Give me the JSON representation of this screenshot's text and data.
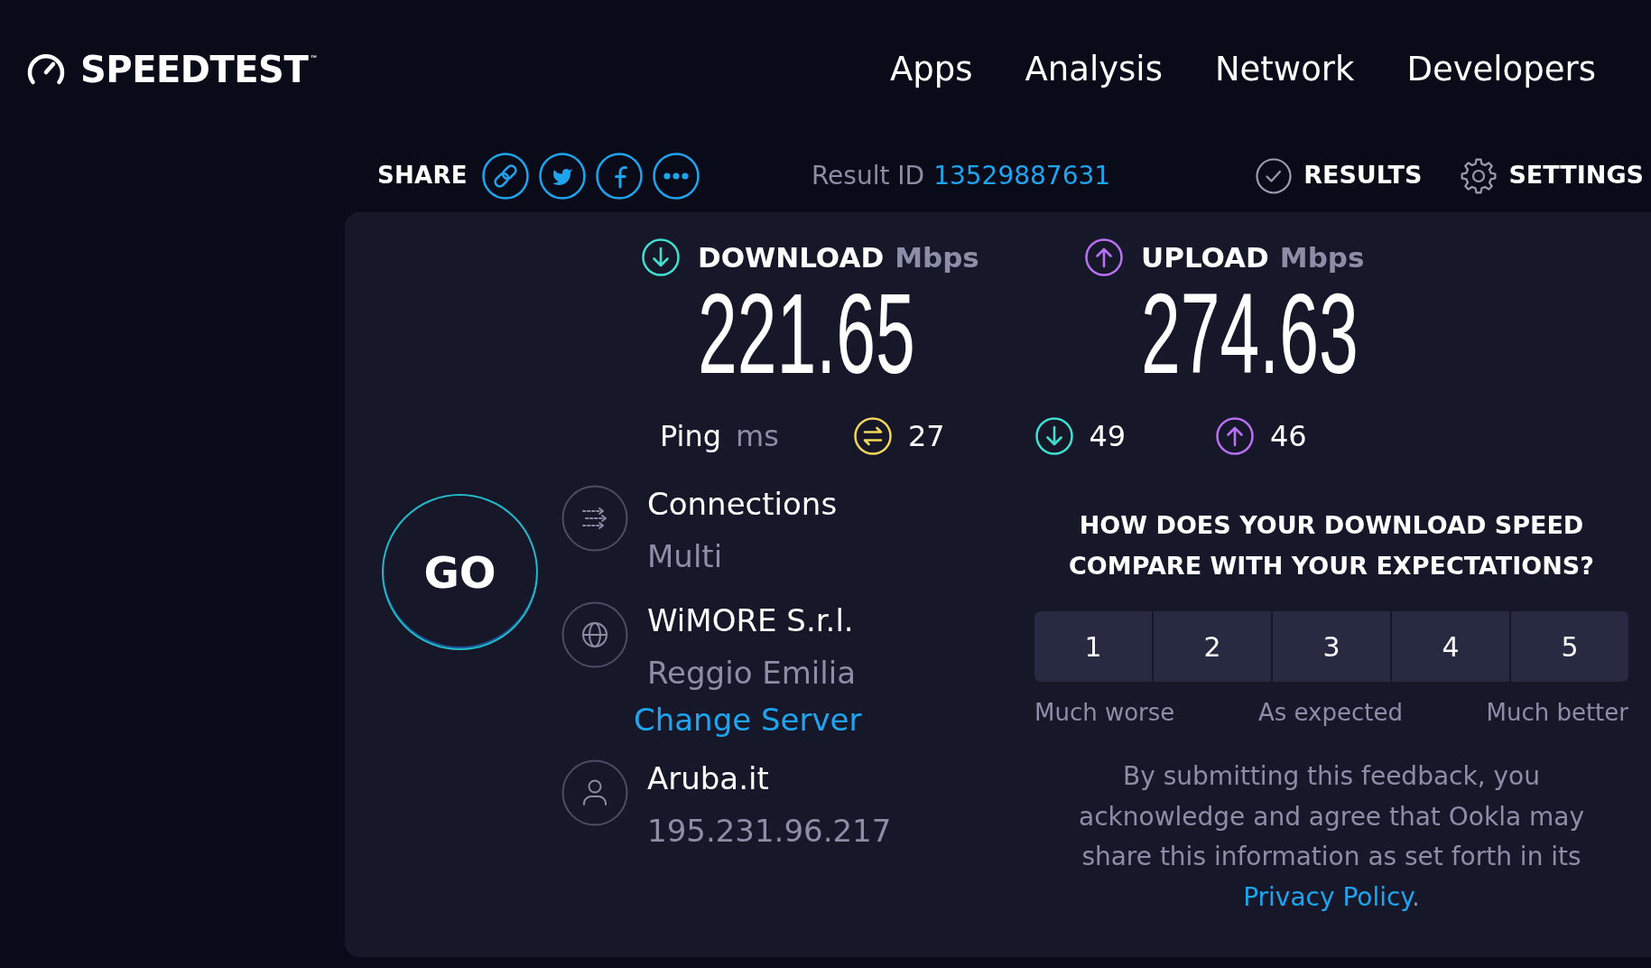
{
  "header": {
    "logo": "SPEEDTEST$^{™}$",
    "nav": [
      "Apps",
      "Analysis",
      "Network",
      "Developers"
    ]
  },
  "share": {
    "label": "SHARE"
  },
  "result": {
    "label": "Result ID",
    "id": "13529887631"
  },
  "actions": [
    {
      "kind": "results",
      "label": "RESULTS"
    },
    {
      "kind": "settings",
      "label": "SETTINGS"
    }
  ],
  "speeds": [
    {
      "kind": "download",
      "label": "DOWNLOAD",
      "unit": "Mbps",
      "value": "221.65"
    },
    {
      "kind": "upload",
      "label": "UPLOAD",
      "unit": "Mbps",
      "value": "274.63"
    }
  ],
  "ping": {
    "label": "Ping",
    "unit": "ms",
    "stats": [
      {
        "kind": "idle",
        "value": "27"
      },
      {
        "kind": "download",
        "value": "49"
      },
      {
        "kind": "upload",
        "value": "46"
      }
    ]
  },
  "go_button": "GO",
  "details": [
    {
      "kind": "connections",
      "title": "Connections",
      "subtitle": "Multi"
    },
    {
      "kind": "server",
      "title": "WiMORE S.r.l.",
      "subtitle": "Reggio Emilia",
      "link": "Change Server"
    },
    {
      "kind": "provider",
      "title": "Aruba.it",
      "subtitle": "195.231.96.217"
    }
  ],
  "survey": {
    "question": "HOW DOES YOUR DOWNLOAD SPEED COMPARE WITH YOUR EXPECTATIONS?",
    "ratings": [
      {
        "label": "1",
        "selected": false
      },
      {
        "label": "2",
        "selected": false
      },
      {
        "label": "3",
        "selected": false
      },
      {
        "label": "4",
        "selected": false
      },
      {
        "label": "5",
        "selected": false
      }
    ],
    "scale_labels": [
      "Much worse",
      "As expected",
      "Much better"
    ],
    "disclaimer": "By submitting this feedback, you acknowledge and agree that Ookla may share this information as set forth in its",
    "policy_link": "Privacy Policy",
    "disclaimer_end": "."
  }
}
